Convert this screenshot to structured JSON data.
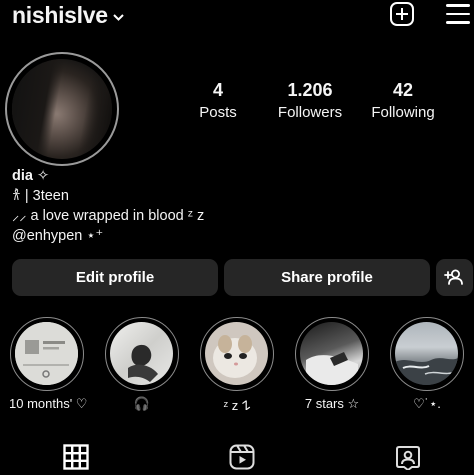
{
  "header": {
    "username": "nishislve",
    "username_chevron": "chevron-down-icon",
    "add_icon": "plus-square-icon",
    "menu_icon": "hamburger-menu-icon"
  },
  "profile": {
    "stats": [
      {
        "value": "4",
        "label": "Posts"
      },
      {
        "value": "1.206",
        "label": "Followers"
      },
      {
        "value": "42",
        "label": "Following"
      }
    ],
    "name": "dia ✧",
    "bio_lines": [
      "𐀪 | 3teen",
      "⸝⸝ a love wrapped in blood ᶻ z",
      "@enhypen ⋆⁺"
    ]
  },
  "actions": {
    "edit_profile": "Edit profile",
    "share_profile": "Share profile",
    "add_friend_icon": "add-person-icon"
  },
  "highlights": [
    {
      "label": "10 months' ♡"
    },
    {
      "label": "🎧"
    },
    {
      "label": "ᶻ z 𐰁"
    },
    {
      "label": "7 stars ☆"
    },
    {
      "label": "♡˙⋆."
    }
  ],
  "tabs": [
    {
      "icon": "grid-icon"
    },
    {
      "icon": "reels-icon"
    },
    {
      "icon": "tagged-icon"
    }
  ]
}
